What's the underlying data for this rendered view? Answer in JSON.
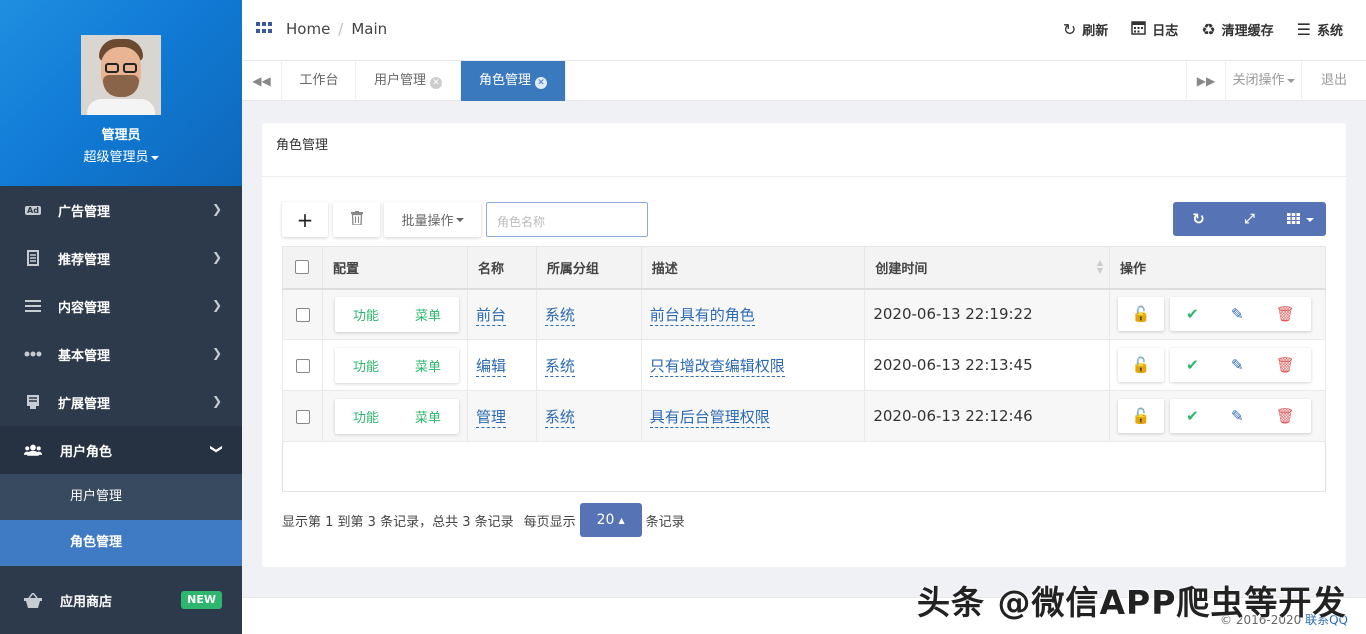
{
  "profile": {
    "name": "管理员",
    "role": "超级管理员"
  },
  "sidebar": {
    "items": [
      {
        "label": "广告管理",
        "icon": "ad-icon"
      },
      {
        "label": "推荐管理",
        "icon": "book-icon"
      },
      {
        "label": "内容管理",
        "icon": "list-icon"
      },
      {
        "label": "基本管理",
        "icon": "dots-icon"
      },
      {
        "label": "扩展管理",
        "icon": "doc-icon"
      },
      {
        "label": "用户角色",
        "icon": "users-icon"
      }
    ],
    "subitems": [
      "用户管理",
      "角色管理"
    ],
    "store": {
      "label": "应用商店",
      "badge": "NEW"
    }
  },
  "header": {
    "breadcrumb": [
      "Home",
      "Main"
    ],
    "buttons": [
      "刷新",
      "日志",
      "清理缓存",
      "系统"
    ]
  },
  "tabs": {
    "items": [
      "工作台",
      "用户管理",
      "角色管理"
    ],
    "close_ops": "关闭操作",
    "logout": "退出"
  },
  "panel": {
    "title": "角色管理"
  },
  "toolbar": {
    "batch": "批量操作",
    "search_placeholder": "角色名称"
  },
  "table": {
    "headers": [
      "配置",
      "名称",
      "所属分组",
      "描述",
      "创建时间",
      "操作"
    ],
    "config_buttons": [
      "功能",
      "菜单"
    ],
    "rows": [
      {
        "name": "前台",
        "group": "系统",
        "desc": "前台具有的角色",
        "created": "2020-06-13 22:19:22"
      },
      {
        "name": "编辑",
        "group": "系统",
        "desc": "只有增改查编辑权限",
        "created": "2020-06-13 22:13:45"
      },
      {
        "name": "管理",
        "group": "系统",
        "desc": "具有后台管理权限",
        "created": "2020-06-13 22:12:46"
      }
    ]
  },
  "pager": {
    "text1": "显示第 1 到第 3 条记录，总共 3 条记录",
    "text2": "每页显示",
    "size": "20",
    "text3": "条记录"
  },
  "footer": {
    "copyright": "© 2016-2020",
    "contact": "联系QQ"
  },
  "watermark": "头条 @微信APP爬虫等开发",
  "colors": {
    "sidebar": "#2c3a4b",
    "accent": "#3a79be",
    "button": "#5573b5",
    "green": "#2fb66e",
    "red": "#e05a5a"
  }
}
